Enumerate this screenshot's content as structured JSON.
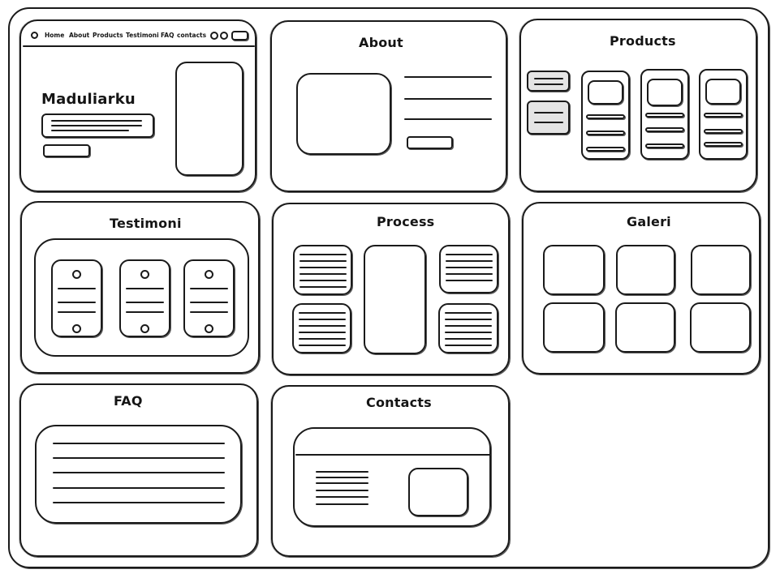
{
  "hero": {
    "brand": "Maduliarku",
    "nav": [
      "Home",
      "About",
      "Products",
      "Testimoni",
      "FAQ",
      "contacts"
    ]
  },
  "sections": {
    "about": "About",
    "products": "Products",
    "testimoni": "Testimoni",
    "process": "Process",
    "galeri": "Galeri",
    "faq": "FAQ",
    "contacts": "Contacts"
  },
  "colors": {
    "stroke": "#1a1a1a",
    "background": "#ffffff",
    "placeholder_fill": "#e4e4e4"
  }
}
